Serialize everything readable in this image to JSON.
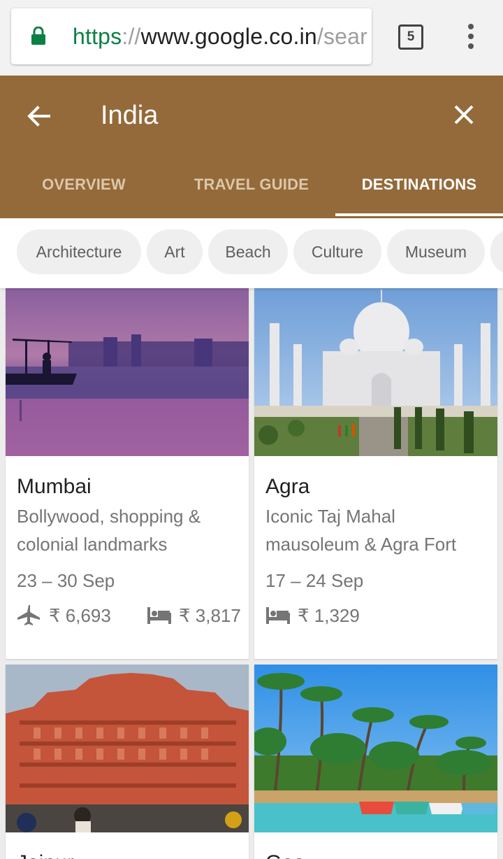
{
  "browser": {
    "url_scheme": "https",
    "url_sep": "://",
    "url_host": "www.google.co.in",
    "url_path": "/sear",
    "tab_count": "5",
    "lock_icon": "lock-icon",
    "menu_icon": "more-vert-icon"
  },
  "header": {
    "title": "India",
    "back_icon": "arrow-back-icon",
    "close_icon": "close-icon",
    "color": "#946a3a"
  },
  "tabs": [
    {
      "label": "OVERVIEW",
      "active": false
    },
    {
      "label": "TRAVEL GUIDE",
      "active": false
    },
    {
      "label": "DESTINATIONS",
      "active": true
    }
  ],
  "chips": [
    {
      "label": "Architecture"
    },
    {
      "label": "Art"
    },
    {
      "label": "Beach"
    },
    {
      "label": "Culture"
    },
    {
      "label": "Museum"
    }
  ],
  "destinations": [
    {
      "name": "Mumbai",
      "description": "Bollywood, shopping & colonial landmarks",
      "dates": "23 – 30 Sep",
      "flight_price": "₹ 6,693",
      "hotel_price": "₹ 3,817"
    },
    {
      "name": "Agra",
      "description": "Iconic Taj Mahal mausoleum & Agra Fort",
      "dates": "17 – 24 Sep",
      "hotel_price": "₹ 1,329"
    },
    {
      "name": "Jaipur"
    },
    {
      "name": "Goa"
    }
  ]
}
